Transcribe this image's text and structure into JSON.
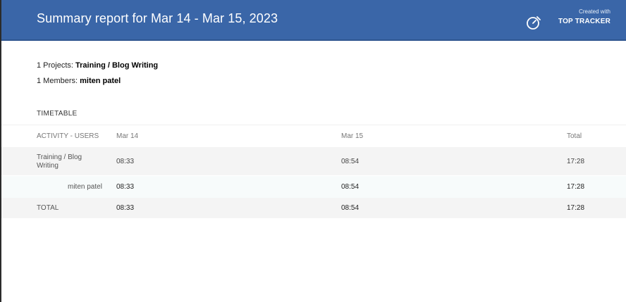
{
  "header": {
    "title": "Summary report for Mar 14 - Mar 15, 2023",
    "brand_created": "Created with",
    "brand_name": "TOP TRACKER",
    "brand_icon": "stopwatch-icon",
    "color": "#3a66a8"
  },
  "summary": {
    "projects_label": "1 Projects:",
    "projects_value": "Training / Blog Writing",
    "members_label": "1 Members:",
    "members_value": "miten patel"
  },
  "timetable": {
    "title": "TIMETABLE",
    "columns": [
      "ACTIVITY - USERS",
      "Mar 14",
      "Mar 15",
      "Total"
    ],
    "project_row": {
      "label": "Training / Blog Writing",
      "values": [
        "08:33",
        "08:54",
        "17:28"
      ]
    },
    "user_row": {
      "label": "miten patel",
      "values": [
        "08:33",
        "08:54",
        "17:28"
      ]
    },
    "total_row": {
      "label": "TOTAL",
      "values": [
        "08:33",
        "08:54",
        "17:28"
      ]
    }
  }
}
